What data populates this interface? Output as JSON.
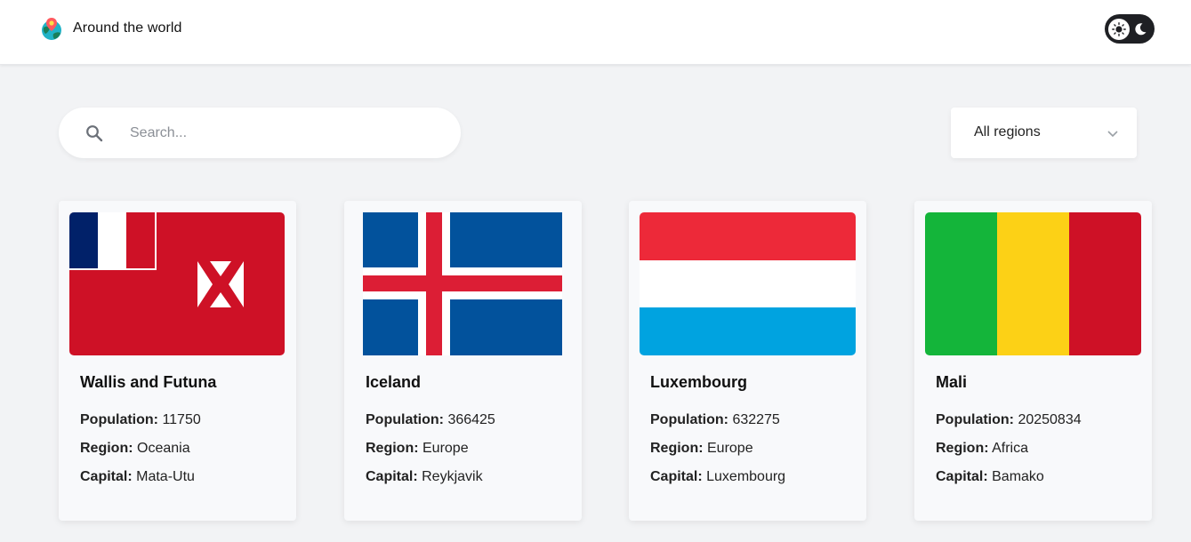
{
  "app": {
    "title": "Around the world",
    "icon": "globe-pin-icon"
  },
  "header": {
    "theme_toggle": {
      "icons": [
        "sun-icon",
        "moon-icon"
      ]
    }
  },
  "search": {
    "placeholder": "Search...",
    "value": ""
  },
  "filter": {
    "selected": "All regions"
  },
  "labels": {
    "population": "Population:",
    "region": "Region:",
    "capital": "Capital:"
  },
  "countries": [
    {
      "name": "Wallis and Futuna",
      "population": "11750",
      "region": "Oceania",
      "capital": "Mata-Utu",
      "flag": "wallis-and-futuna-flag"
    },
    {
      "name": "Iceland",
      "population": "366425",
      "region": "Europe",
      "capital": "Reykjavik",
      "flag": "iceland-flag"
    },
    {
      "name": "Luxembourg",
      "population": "632275",
      "region": "Europe",
      "capital": "Luxembourg",
      "flag": "luxembourg-flag"
    },
    {
      "name": "Mali",
      "population": "20250834",
      "region": "Africa",
      "capital": "Bamako",
      "flag": "mali-flag"
    }
  ],
  "colors": {
    "background": "#f2f3f5",
    "card": "#f8f9fb",
    "toggle": "#1f2024",
    "wallis_red": "#ce1126",
    "wallis_blue": "#012169",
    "iceland_blue": "#02529c",
    "iceland_red": "#dc1e35",
    "lux_red": "#ed2939",
    "lux_blue": "#00a3e0",
    "mali_green": "#14b53a",
    "mali_yellow": "#fcd116",
    "mali_red": "#ce1126"
  }
}
